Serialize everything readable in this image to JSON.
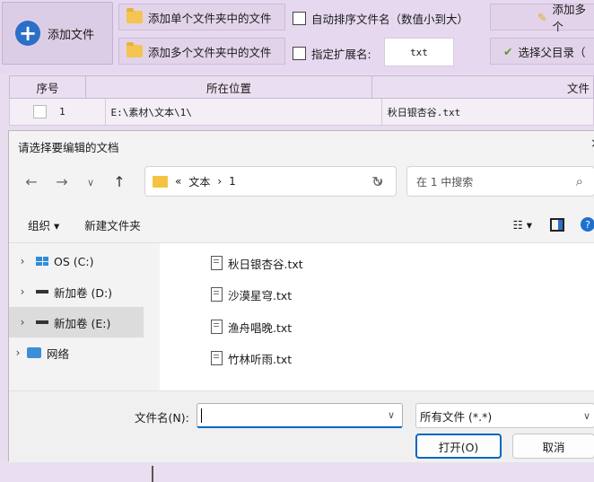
{
  "toolbar": {
    "add_file": "添加文件",
    "add_single_folder": "添加单个文件夹中的文件",
    "add_multi_folder": "添加多个文件夹中的文件",
    "auto_sort": "自动排序文件名（数值小到大）",
    "specify_ext": "指定扩展名:",
    "ext_value": "txt",
    "add_multi_right": "添加多个",
    "choose_parent": "选择父目录（"
  },
  "table": {
    "headers": [
      "序号",
      "所在位置",
      "文件"
    ],
    "rows": [
      {
        "index": "1",
        "location": "E:\\素材\\文本\\1\\",
        "file": "秋日银杏谷.txt"
      }
    ]
  },
  "dialog": {
    "title": "请选择要编辑的文档",
    "close": "×",
    "back": "←",
    "forward": "→",
    "recent": "∨",
    "up": "↑",
    "path_prefix": "«",
    "path_folder": "文本",
    "path_sep": "›",
    "path_current": "1",
    "path_dropdown": "∨",
    "refresh": "↻",
    "search_placeholder": "在 1 中搜索",
    "search_icon": "⌕",
    "organize": "组织 ▾",
    "new_folder": "新建文件夹",
    "view_icon": "☷ ▾",
    "help": "?",
    "nav": [
      {
        "label": "OS (C:)",
        "chevron": "›"
      },
      {
        "label": "新加卷 (D:)",
        "chevron": "›"
      },
      {
        "label": "新加卷 (E:)",
        "chevron": "›"
      },
      {
        "label": "网络",
        "chevron": "›"
      }
    ],
    "files": [
      "秋日银杏谷.txt",
      "沙漠星穹.txt",
      "渔舟唱晚.txt",
      "竹林听雨.txt"
    ],
    "filename_label": "文件名(N):",
    "filename_value": "",
    "filename_dropdown": "∨",
    "filetype": "所有文件 (*.*)",
    "filetype_dropdown": "∨",
    "open": "打开(O)",
    "cancel": "取消"
  },
  "colors": {
    "accent": "#0067c0",
    "app_bg": "#e8dcef"
  }
}
